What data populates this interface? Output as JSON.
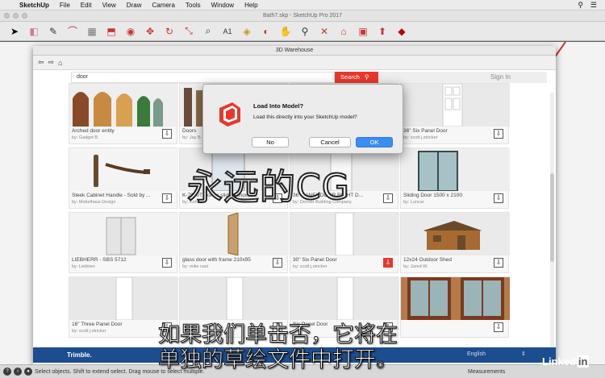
{
  "menubar": {
    "app": "SketchUp",
    "items": [
      "File",
      "Edit",
      "View",
      "Draw",
      "Camera",
      "Tools",
      "Window",
      "Help"
    ]
  },
  "window_title": "Bath7.skp - SketchUp Pro 2017",
  "toolbar_icons": [
    "select-icon",
    "eraser-icon",
    "pencil-icon",
    "arc-icon",
    "shape-icon",
    "push-pull-icon",
    "offset-icon",
    "move-icon",
    "rotate-icon",
    "scale-icon",
    "tape-icon",
    "text-icon",
    "paint-icon",
    "orbit-icon",
    "pan-icon",
    "zoom-icon",
    "zoom-extents-icon",
    "warehouse-icon",
    "extension-icon",
    "share-icon",
    "ruby-icon"
  ],
  "warehouse": {
    "title": "3D Warehouse",
    "search_value": "door",
    "search_button": "Search",
    "sign_in": "Sign In",
    "footer_brand": "Trimble.",
    "footer_lang": "English"
  },
  "tiles": [
    {
      "name": "Arched door entity",
      "by": "by: Gadget B."
    },
    {
      "name": "Doors",
      "by": "by: Jay B."
    },
    {
      "name": "",
      "by": ""
    },
    {
      "name": "36\" Six Panel Door",
      "by": "by: scott j.stricker"
    },
    {
      "name": "Sleek Cabinet Handle - Sold by ...",
      "by": "by: Mobelhaus Design"
    },
    {
      "name": "K-7070T Kohler sliding shower...",
      "by": "by: Kohler"
    },
    {
      "name": "36\" PANEL DOOR RIGHT D...",
      "by": "by: Denver Building Company"
    },
    {
      "name": "Sliding Door 1500 x 2100",
      "by": "by: Luncar"
    },
    {
      "name": "LIEBHERR - SBS 5712",
      "by": "by: Liebherr"
    },
    {
      "name": "glass door with frame 210x95",
      "by": "by: mike cast"
    },
    {
      "name": "30\" Six Panel Door",
      "by": "by: scott j.stricker"
    },
    {
      "name": "12x24 Outdoor Shed",
      "by": "by: Jared W."
    },
    {
      "name": "16\" Three Panel Door",
      "by": "by: scott j.stricker"
    },
    {
      "name": "",
      "by": ""
    },
    {
      "name": "Six Panel Door",
      "by": ""
    },
    {
      "name": "",
      "by": ""
    }
  ],
  "dialog": {
    "title": "Load Into Model?",
    "message": "Load this directly into your SketchUp model?",
    "no": "No",
    "cancel": "Cancel",
    "ok": "OK"
  },
  "watermark": "永远的CG",
  "subtitle_line1": "如果我们单击否，它将在",
  "subtitle_line2": "单独的草绘文件中打开。",
  "status": {
    "text": "Select objects. Shift to extend select. Drag mouse to select multiple.",
    "measurements": "Measurements"
  },
  "brand_mark": {
    "text": "Linked",
    "box": "in"
  }
}
